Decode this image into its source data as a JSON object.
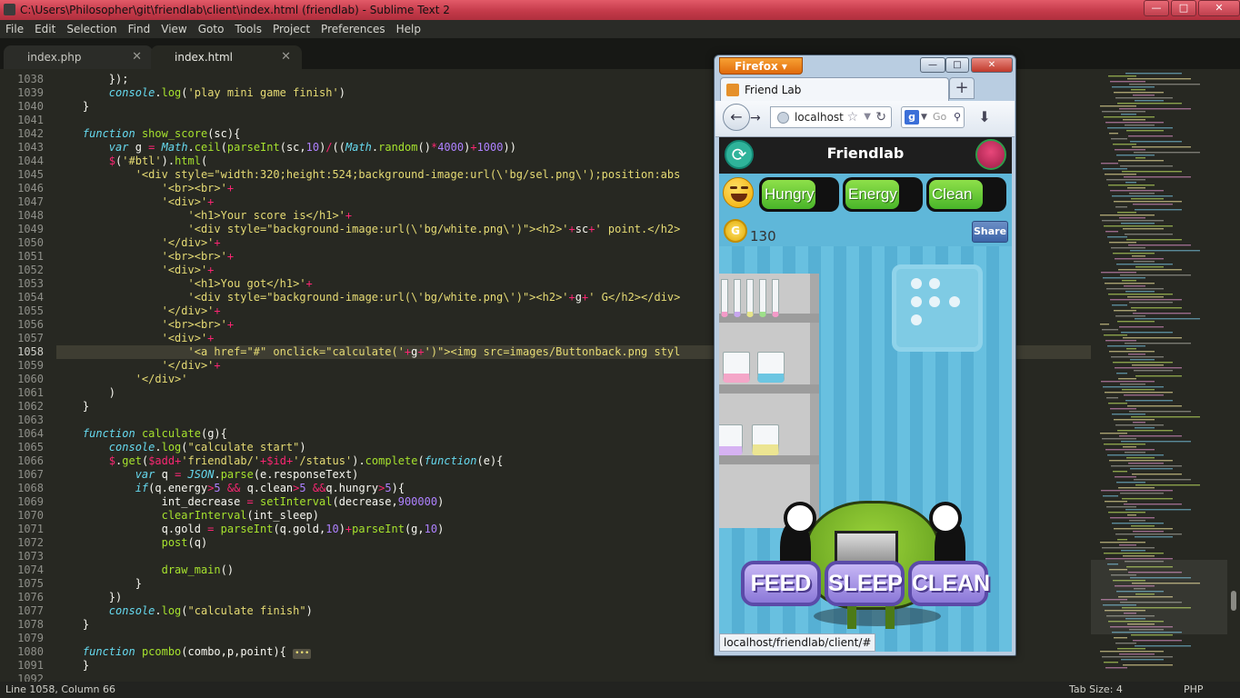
{
  "window": {
    "title": "C:\\Users\\Philosopher\\git\\friendlab\\client\\index.html (friendlab) - Sublime Text 2",
    "controls": [
      "minimize",
      "maximize",
      "close"
    ]
  },
  "menu": [
    "File",
    "Edit",
    "Selection",
    "Find",
    "View",
    "Goto",
    "Tools",
    "Project",
    "Preferences",
    "Help"
  ],
  "tabs": [
    {
      "label": "index.php",
      "active": false
    },
    {
      "label": "index.html",
      "active": true
    }
  ],
  "editor": {
    "current_line": "1058",
    "lines": [
      {
        "n": "1038",
        "code": "        });"
      },
      {
        "n": "1039",
        "code": "        console.log('play mini game finish')"
      },
      {
        "n": "1040",
        "code": "    }"
      },
      {
        "n": "1041",
        "code": ""
      },
      {
        "n": "1042",
        "code": "    function show_score(sc){"
      },
      {
        "n": "1043",
        "code": "        var g = Math.ceil(parseInt(sc,10)/((Math.random()*4000)+1000))"
      },
      {
        "n": "1044",
        "code": "        $('#btl').html("
      },
      {
        "n": "1045",
        "code": "            '<div style=\"width:320;height:524;background-image:url(\\'bg/sel.png\\');position:abs"
      },
      {
        "n": "1046",
        "code": "                '<br><br>'+"
      },
      {
        "n": "1047",
        "code": "                '<div>'+"
      },
      {
        "n": "1048",
        "code": "                    '<h1>Your score is</h1>'+"
      },
      {
        "n": "1049",
        "code": "                    '<div style=\"background-image:url(\\'bg/white.png\\')\"><h2>'+sc+' point.</h2>"
      },
      {
        "n": "1050",
        "code": "                '</div>'+"
      },
      {
        "n": "1051",
        "code": "                '<br><br>'+"
      },
      {
        "n": "1052",
        "code": "                '<div>'+"
      },
      {
        "n": "1053",
        "code": "                    '<h1>You got</h1>'+"
      },
      {
        "n": "1054",
        "code": "                    '<div style=\"background-image:url(\\'bg/white.png\\')\"><h2>'+g+' G</h2></div>"
      },
      {
        "n": "1055",
        "code": "                '</div>'+"
      },
      {
        "n": "1056",
        "code": "                '<br><br>'+"
      },
      {
        "n": "1057",
        "code": "                '<div>'+"
      },
      {
        "n": "1058",
        "code": "                    '<a href=\"#\" onclick=\"calculate('+g+')\"><img src=images/Buttonback.png styl"
      },
      {
        "n": "1059",
        "code": "                '</div>'+"
      },
      {
        "n": "1060",
        "code": "            '</div>'"
      },
      {
        "n": "1061",
        "code": "        )"
      },
      {
        "n": "1062",
        "code": "    }"
      },
      {
        "n": "1063",
        "code": ""
      },
      {
        "n": "1064",
        "code": "    function calculate(g){"
      },
      {
        "n": "1065",
        "code": "        console.log(\"calculate start\")"
      },
      {
        "n": "1066",
        "code": "        $.get($add+'friendlab/'+$id+'/status').complete(function(e){"
      },
      {
        "n": "1067",
        "code": "            var q = JSON.parse(e.responseText)"
      },
      {
        "n": "1068",
        "code": "            if(q.energy>5 && q.clean>5 &&q.hungry>5){"
      },
      {
        "n": "1069",
        "code": "                int_decrease = setInterval(decrease,900000)"
      },
      {
        "n": "1070",
        "code": "                clearInterval(int_sleep)"
      },
      {
        "n": "1071",
        "code": "                q.gold = parseInt(q.gold,10)+parseInt(g,10)"
      },
      {
        "n": "1072",
        "code": "                post(q)"
      },
      {
        "n": "1073",
        "code": ""
      },
      {
        "n": "1074",
        "code": "                draw_main()"
      },
      {
        "n": "1075",
        "code": "            }"
      },
      {
        "n": "1076",
        "code": "        })"
      },
      {
        "n": "1077",
        "code": "        console.log(\"calculate finish\")"
      },
      {
        "n": "1078",
        "code": "    }"
      },
      {
        "n": "1079",
        "code": ""
      },
      {
        "n": "1080",
        "code": "    function pcombo(combo,p,point){"
      },
      {
        "n": "1091",
        "code": "    }"
      },
      {
        "n": "1092",
        "code": ""
      }
    ]
  },
  "statusbar": {
    "position": "Line 1058, Column 66",
    "tab_size": "Tab Size: 4",
    "syntax": "PHP"
  },
  "firefox": {
    "menu_button": "Firefox",
    "tab_title": "Friend Lab",
    "new_tab": "+",
    "url": "localhost",
    "search_placeholder": "Go",
    "status_url": "localhost/friendlab/client/#",
    "page": {
      "title": "Friendlab",
      "stats": [
        {
          "label": "Hungry",
          "level": 0.72
        },
        {
          "label": "Energy",
          "level": 0.72
        },
        {
          "label": "Clean",
          "level": 0.72
        }
      ],
      "coin_letter": "G",
      "gold": "130",
      "share": "Share",
      "actions": [
        "FEED",
        "SLEEP",
        "CLEAN"
      ]
    }
  }
}
